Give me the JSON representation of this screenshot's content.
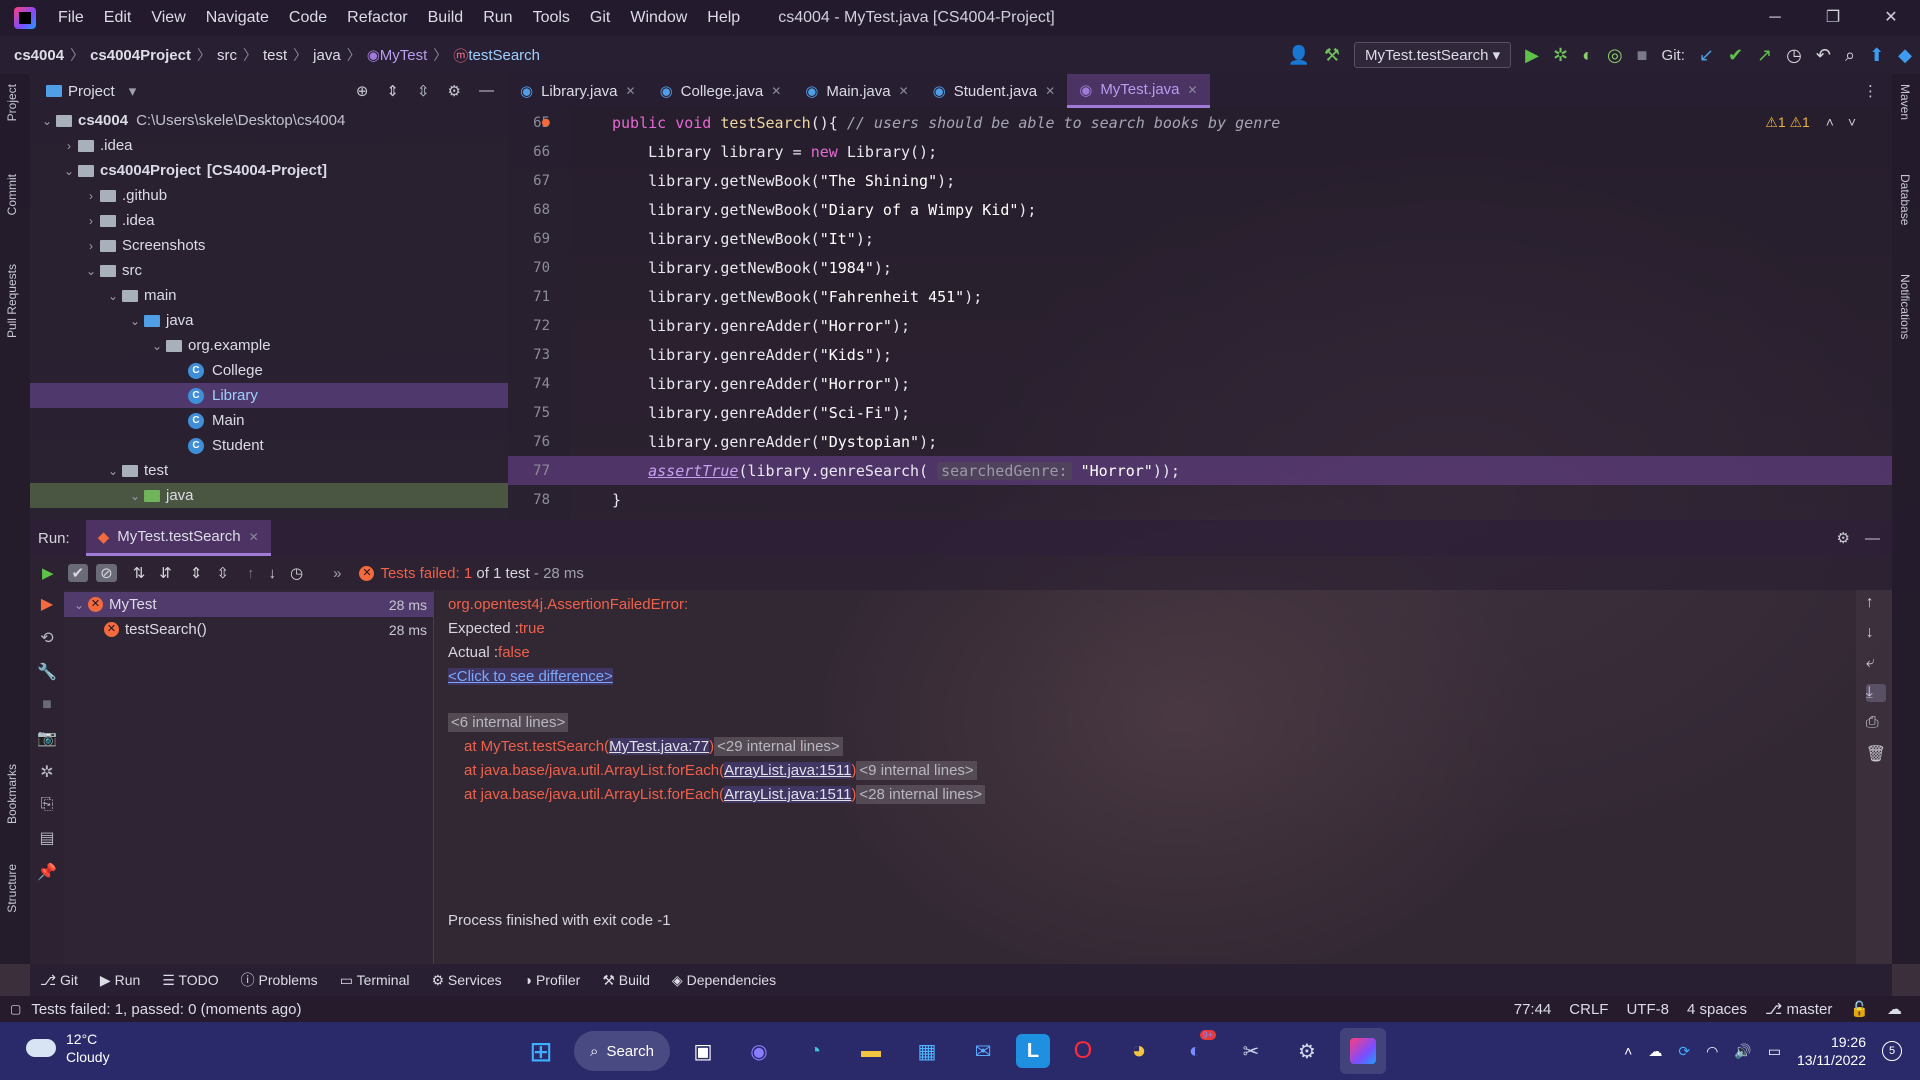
{
  "window": {
    "title": "cs4004 - MyTest.java [CS4004-Project]",
    "menu": [
      "File",
      "Edit",
      "View",
      "Navigate",
      "Code",
      "Refactor",
      "Build",
      "Run",
      "Tools",
      "Git",
      "Window",
      "Help"
    ],
    "controls": [
      "─",
      "❐",
      "✕"
    ]
  },
  "breadcrumb": [
    "cs4004",
    "cs4004Project",
    "src",
    "test",
    "java",
    "MyTest",
    "testSearch"
  ],
  "toolbar": {
    "run_config": "MyTest.testSearch",
    "git_label": "Git:"
  },
  "left_strip": [
    "Project",
    "Commit",
    "Pull Requests",
    "Bookmarks",
    "Structure"
  ],
  "right_strip": [
    "Maven",
    "Database",
    "Notifications"
  ],
  "project_panel": {
    "title": "Project",
    "tree": [
      {
        "label": "cs4004",
        "path": "C:\\Users\\skele\\Desktop\\cs4004"
      },
      {
        "label": ".idea"
      },
      {
        "label": "cs4004Project",
        "suffix": "[CS4004-Project]"
      },
      {
        "label": ".github"
      },
      {
        "label": ".idea"
      },
      {
        "label": "Screenshots"
      },
      {
        "label": "src"
      },
      {
        "label": "main"
      },
      {
        "label": "java"
      },
      {
        "label": "org.example"
      },
      {
        "label": "College"
      },
      {
        "label": "Library"
      },
      {
        "label": "Main"
      },
      {
        "label": "Student"
      },
      {
        "label": "test"
      },
      {
        "label": "java"
      }
    ]
  },
  "tabs": [
    "Library.java",
    "College.java",
    "Main.java",
    "Student.java",
    "MyTest.java"
  ],
  "editor": {
    "warnings": "⚠1  ⚠1",
    "lines": [
      {
        "n": "65",
        "parts": [
          [
            "kw",
            "public void "
          ],
          [
            "meth",
            "testSearch"
          ],
          [
            "fn",
            "(){ "
          ],
          [
            "cmt",
            "// users should be able to search books by genre"
          ]
        ]
      },
      {
        "n": "66",
        "parts": [
          [
            "fn",
            "    Library library = "
          ],
          [
            "kw",
            "new "
          ],
          [
            "fn",
            "Library();"
          ]
        ]
      },
      {
        "n": "67",
        "parts": [
          [
            "fn",
            "    library.getNewBook("
          ],
          [
            "str",
            "\"The Shining\""
          ],
          [
            "fn",
            ");"
          ]
        ]
      },
      {
        "n": "68",
        "parts": [
          [
            "fn",
            "    library.getNewBook("
          ],
          [
            "str",
            "\"Diary of a Wimpy Kid\""
          ],
          [
            "fn",
            ");"
          ]
        ]
      },
      {
        "n": "69",
        "parts": [
          [
            "fn",
            "    library.getNewBook("
          ],
          [
            "str",
            "\"It\""
          ],
          [
            "fn",
            ");"
          ]
        ]
      },
      {
        "n": "70",
        "parts": [
          [
            "fn",
            "    library.getNewBook("
          ],
          [
            "str",
            "\"1984\""
          ],
          [
            "fn",
            ");"
          ]
        ]
      },
      {
        "n": "71",
        "parts": [
          [
            "fn",
            "    library.getNewBook("
          ],
          [
            "str",
            "\"Fahrenheit 451\""
          ],
          [
            "fn",
            ");"
          ]
        ]
      },
      {
        "n": "72",
        "parts": [
          [
            "fn",
            "    library.genreAdder("
          ],
          [
            "str",
            "\"Horror\""
          ],
          [
            "fn",
            ");"
          ]
        ]
      },
      {
        "n": "73",
        "parts": [
          [
            "fn",
            "    library.genreAdder("
          ],
          [
            "str",
            "\"Kids\""
          ],
          [
            "fn",
            ");"
          ]
        ]
      },
      {
        "n": "74",
        "parts": [
          [
            "fn",
            "    library.genreAdder("
          ],
          [
            "str",
            "\"Horror\""
          ],
          [
            "fn",
            ");"
          ]
        ]
      },
      {
        "n": "75",
        "parts": [
          [
            "fn",
            "    library.genreAdder("
          ],
          [
            "str",
            "\"Sci-Fi\""
          ],
          [
            "fn",
            ");"
          ]
        ]
      },
      {
        "n": "76",
        "parts": [
          [
            "fn",
            "    library.genreAdder("
          ],
          [
            "str",
            "\"Dystopian\""
          ],
          [
            "fn",
            ");"
          ]
        ]
      },
      {
        "n": "77",
        "parts": [
          [
            "fn",
            "    "
          ],
          [
            "under",
            "assertTrue"
          ],
          [
            "fn",
            "(library.genreSearch( "
          ],
          [
            "hint",
            "searchedGenre:"
          ],
          [
            "str",
            " \"Horror\""
          ],
          [
            "fn",
            "));"
          ]
        ]
      },
      {
        "n": "78",
        "parts": [
          [
            "fn",
            "}"
          ]
        ]
      }
    ]
  },
  "run": {
    "label": "Run:",
    "tab": "MyTest.testSearch",
    "summary_prefix": "Tests failed:",
    "summary_count": "1",
    "summary_rest": "of 1 test",
    "summary_time": "- 28 ms",
    "tree": [
      {
        "label": "MyTest",
        "time": "28 ms"
      },
      {
        "label": "testSearch()",
        "time": "28 ms"
      }
    ],
    "console": {
      "error": "org.opentest4j.AssertionFailedError:",
      "expected_label": "Expected :",
      "expected_value": "true",
      "actual_label": "Actual   :",
      "actual_value": "false",
      "diff_link": "<Click to see difference>",
      "internal1": "<6 internal lines>",
      "trace": [
        {
          "at": "at MyTest.testSearch(",
          "link": "MyTest.java:77",
          "close": ")",
          "internal": "<29 internal lines>"
        },
        {
          "at": "at java.base/java.util.ArrayList.forEach(",
          "link": "ArrayList.java:1511",
          "close": ")",
          "internal": "<9 internal lines>"
        },
        {
          "at": "at java.base/java.util.ArrayList.forEach(",
          "link": "ArrayList.java:1511",
          "close": ")",
          "internal": "<28 internal lines>"
        }
      ],
      "exit": "Process finished with exit code -1"
    }
  },
  "tool_windows": [
    "Git",
    "Run",
    "TODO",
    "Problems",
    "Terminal",
    "Services",
    "Profiler",
    "Build",
    "Dependencies"
  ],
  "status": {
    "message": "Tests failed: 1, passed: 0 (moments ago)",
    "position": "77:44",
    "line_sep": "CRLF",
    "encoding": "UTF-8",
    "indent": "4 spaces",
    "branch": "master"
  },
  "taskbar": {
    "weather_temp": "12°C",
    "weather_desc": "Cloudy",
    "search": "Search",
    "time": "19:26",
    "date": "13/11/2022",
    "notif_count": "5",
    "discord_badge": "9+"
  }
}
